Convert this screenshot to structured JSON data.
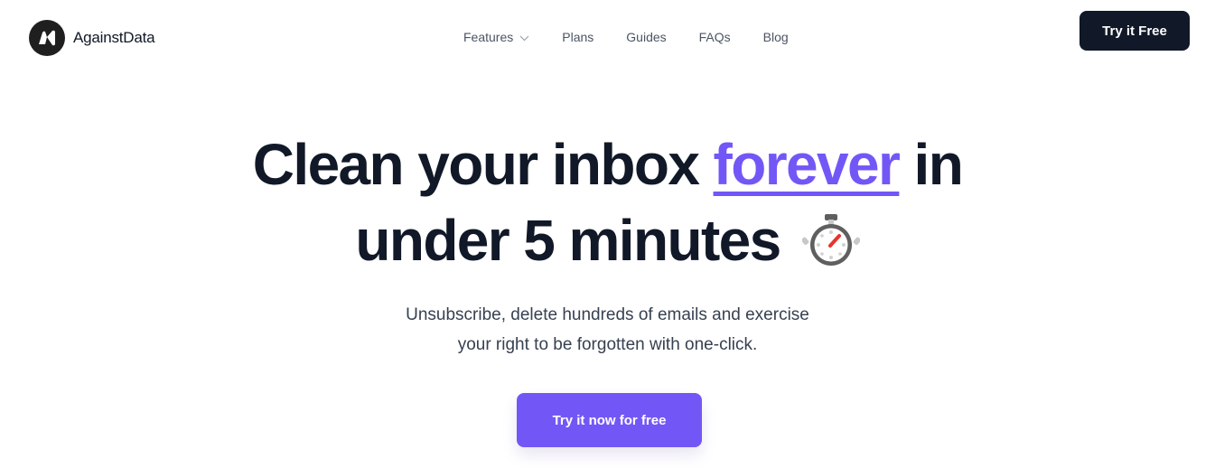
{
  "brand": {
    "name": "AgainstData",
    "logo_icon": "againstdata-logo-icon"
  },
  "nav": {
    "items": [
      {
        "label": "Features",
        "has_dropdown": true,
        "icon": "chevron-down-icon"
      },
      {
        "label": "Plans"
      },
      {
        "label": "Guides"
      },
      {
        "label": "FAQs"
      },
      {
        "label": "Blog"
      }
    ],
    "cta_label": "Try it Free"
  },
  "hero": {
    "title_part1": "Clean your inbox ",
    "title_accent": "forever",
    "title_part2": " in",
    "title_line2": "under 5 minutes",
    "title_icon": "stopwatch-icon",
    "subtitle_line1": "Unsubscribe, delete hundreds of emails and exercise",
    "subtitle_line2": "your right to be forgotten with one-click.",
    "cta_label": "Try it now for free"
  },
  "colors": {
    "accent": "#7357f6",
    "dark": "#111827",
    "text_muted": "#4b5563"
  }
}
